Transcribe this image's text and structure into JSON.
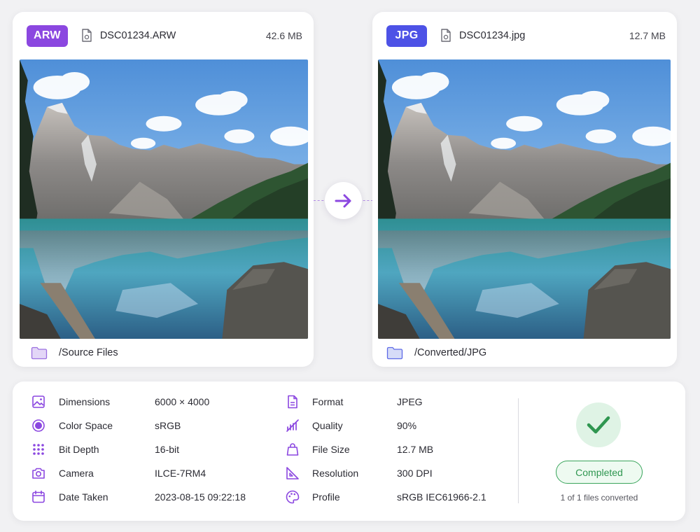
{
  "source": {
    "badge": "ARW",
    "file_name": "DSC01234.ARW",
    "file_size": "42.6 MB",
    "folder": "/Source Files"
  },
  "target": {
    "badge": "JPG",
    "file_name": "DSC01234.jpg",
    "file_size": "12.7 MB",
    "folder": "/Converted/JPG"
  },
  "details_left": [
    {
      "icon": "image-icon",
      "label": "Dimensions",
      "value": "6000 × 4000"
    },
    {
      "icon": "color-space-icon",
      "label": "Color Space",
      "value": "sRGB"
    },
    {
      "icon": "bit-depth-icon",
      "label": "Bit Depth",
      "value": "16-bit"
    },
    {
      "icon": "camera-icon",
      "label": "Camera",
      "value": "ILCE-7RM4"
    },
    {
      "icon": "calendar-icon",
      "label": "Date Taken",
      "value": "2023-08-15 09:22:18"
    }
  ],
  "details_right": [
    {
      "icon": "format-icon",
      "label": "Format",
      "value": "JPEG"
    },
    {
      "icon": "quality-icon",
      "label": "Quality",
      "value": "90%"
    },
    {
      "icon": "file-size-icon",
      "label": "File Size",
      "value": "12.7 MB"
    },
    {
      "icon": "resolution-icon",
      "label": "Resolution",
      "value": "300 DPI"
    },
    {
      "icon": "palette-icon",
      "label": "Profile",
      "value": "sRGB IEC61966-2.1"
    }
  ],
  "status": {
    "label": "Completed",
    "summary": "1 of 1 files converted"
  },
  "colors": {
    "accent_purple": "#8b47e0",
    "accent_blue": "#4d52e6",
    "success_green": "#2f9650"
  }
}
